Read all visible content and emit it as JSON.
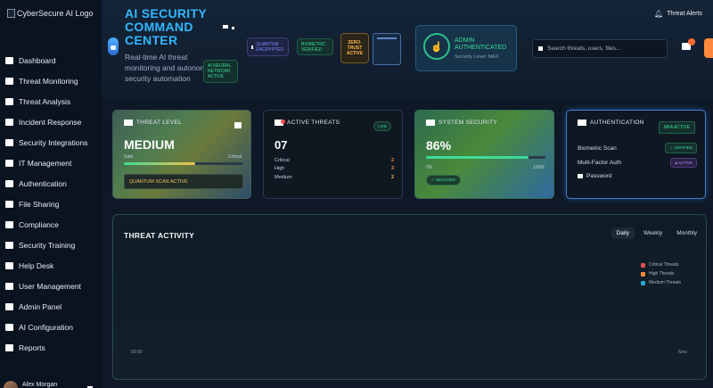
{
  "sidebar": {
    "logo_alt": "CyberSecure AI Logo",
    "items": [
      {
        "label": "Dashboard"
      },
      {
        "label": "Threat Monitoring"
      },
      {
        "label": "Threat Analysis"
      },
      {
        "label": "Incident Response"
      },
      {
        "label": "Security Integrations"
      },
      {
        "label": "IT Management"
      },
      {
        "label": "Authentication"
      },
      {
        "label": "File Sharing"
      },
      {
        "label": "Compliance"
      },
      {
        "label": "Security Training"
      },
      {
        "label": "Help Desk"
      },
      {
        "label": "User Management"
      },
      {
        "label": "Admin Panel"
      },
      {
        "label": "AI Configuration"
      },
      {
        "label": "Reports"
      }
    ],
    "user_name": "Alex Morgan"
  },
  "header": {
    "title": "AI SECURITY COMMAND CENTER",
    "subtitle": "Real-time AI threat monitoring and autonomous security automation",
    "pill_neural": "AI NEURAL NETWORK ACTIVE",
    "pill_quantum": "QUANTUM ENCRYPTED",
    "pill_bio": "BIOMETRIC VERIFIED",
    "pill_zero": "ZERO-TRUST ACTIVE",
    "admin_title": "ADMIN AUTHENTICATED",
    "admin_sub": "Security Level: MAX",
    "search_placeholder": "Search threats, users, files...",
    "alerts_label": "Threat Alerts"
  },
  "cards": {
    "threat_level": {
      "title": "THREAT LEVEL",
      "value": "MEDIUM",
      "low_label": "Safe",
      "high_label": "Critical",
      "level": 0.6,
      "status": "QUANTUM SCAN ACTIVE"
    },
    "active_threats": {
      "title": "ACTIVE THREATS",
      "badge": "LIVE",
      "value": "07",
      "rows": [
        {
          "label": "Critical",
          "value": "2",
          "color": "#ff8a3d"
        },
        {
          "label": "High",
          "value": "3",
          "color": "#ff8a3d"
        },
        {
          "label": "Medium",
          "value": "2",
          "color": "#f2c14e"
        }
      ]
    },
    "system_security": {
      "title": "SYSTEM SECURITY",
      "value": "86%",
      "min_label": "0%",
      "max_label": "100%",
      "level": 0.86,
      "badge": "SECURED"
    },
    "authentication": {
      "title": "AUTHENTICATION",
      "badge": "MFA ACTIVE",
      "biometric_label": "Biometric Scan",
      "biometric_status": "VERIFIED",
      "mfa_label": "Multi-Factor Auth",
      "mfa_status": "ACTIVE",
      "password_label": "Password"
    }
  },
  "activity": {
    "title": "THREAT ACTIVITY",
    "tabs": [
      {
        "label": "Daily"
      },
      {
        "label": "Weekly"
      },
      {
        "label": "Monthly"
      }
    ],
    "legend": [
      {
        "label": "Critical Threats",
        "color": "#e0524f"
      },
      {
        "label": "High Threats",
        "color": "#ff8a3d"
      },
      {
        "label": "Medium Threats",
        "color": "#2aa8d8"
      }
    ],
    "x_start": "00:00",
    "x_end": "Now"
  }
}
